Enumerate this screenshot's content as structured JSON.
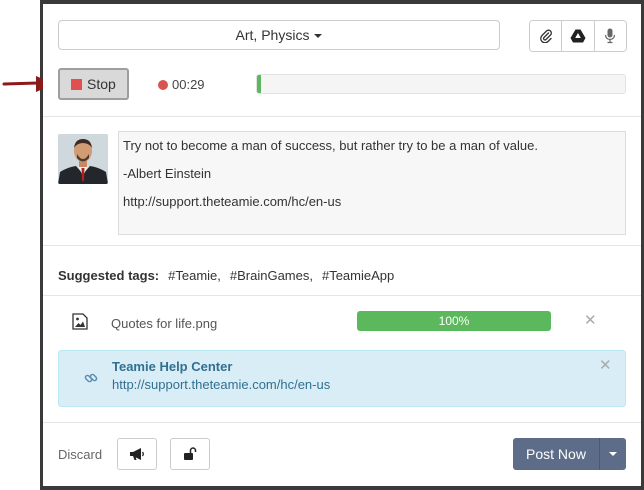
{
  "header": {
    "class_selector_label": "Art, Physics"
  },
  "toolbar": {
    "icons": [
      "paperclip-icon",
      "google-drive-icon",
      "microphone-icon"
    ]
  },
  "recording": {
    "stop_label": "Stop",
    "elapsed": "00:29",
    "progress_fraction": 0.01
  },
  "post": {
    "author_avatar": "avatar",
    "lines": [
      "Try not to become a man of success, but rather try to be a man of value.",
      "-Albert Einstein",
      "http://support.theteamie.com/hc/en-us"
    ]
  },
  "tags": {
    "label": "Suggested tags:",
    "items": [
      "#Teamie,",
      "#BrainGames,",
      "#TeamieApp"
    ]
  },
  "attachment": {
    "file_name": "Quotes for life.png",
    "progress_text": "100%",
    "progress_fraction": 1.0
  },
  "link_preview": {
    "title": "Teamie Help Center",
    "url": "http://support.theteamie.com/hc/en-us"
  },
  "footer": {
    "discard_label": "Discard",
    "post_label": "Post Now"
  },
  "colors": {
    "accent": "#5d6d89",
    "success": "#5cb85c",
    "record": "#d9534f",
    "info_bg": "#d9edf7"
  }
}
